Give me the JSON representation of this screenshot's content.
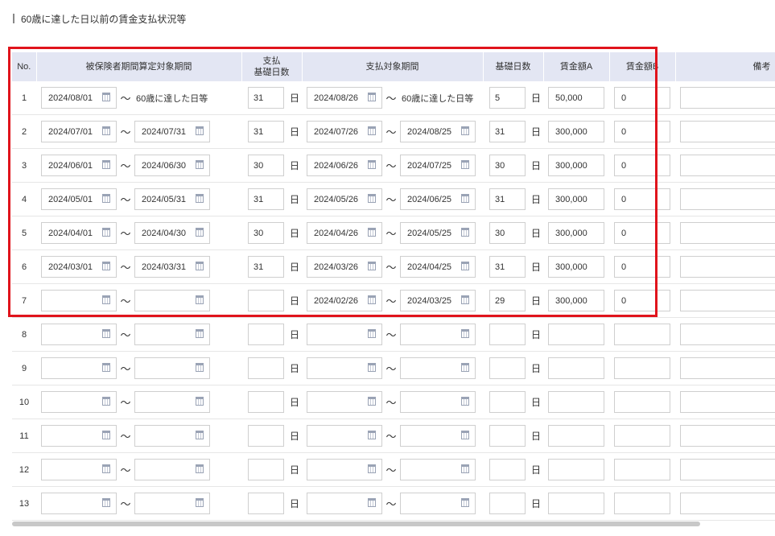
{
  "section_title": "60歳に達した日以前の賃金支払状況等",
  "headers": {
    "no": "No.",
    "insured_period": "被保険者期間算定対象期間",
    "pay_days_line1": "支払",
    "pay_days_line2": "基礎日数",
    "pay_period": "支払対象期間",
    "base_days": "基礎日数",
    "wage_a": "賃金額A",
    "wage_b": "賃金額B",
    "note": "備考"
  },
  "day_unit": "日",
  "tilde": "～",
  "rows": [
    {
      "no": "1",
      "ins_from": "2024/08/01",
      "ins_to": "",
      "ins_to_text": "60歳に達した日等",
      "pay_days": "31",
      "pay_from": "2024/08/26",
      "pay_to": "",
      "pay_to_text": "60歳に達した日等",
      "base_days": "5",
      "wage_a": "50,000",
      "wage_b": "0"
    },
    {
      "no": "2",
      "ins_from": "2024/07/01",
      "ins_to": "2024/07/31",
      "ins_to_text": "",
      "pay_days": "31",
      "pay_from": "2024/07/26",
      "pay_to": "2024/08/25",
      "pay_to_text": "",
      "base_days": "31",
      "wage_a": "300,000",
      "wage_b": "0"
    },
    {
      "no": "3",
      "ins_from": "2024/06/01",
      "ins_to": "2024/06/30",
      "ins_to_text": "",
      "pay_days": "30",
      "pay_from": "2024/06/26",
      "pay_to": "2024/07/25",
      "pay_to_text": "",
      "base_days": "30",
      "wage_a": "300,000",
      "wage_b": "0"
    },
    {
      "no": "4",
      "ins_from": "2024/05/01",
      "ins_to": "2024/05/31",
      "ins_to_text": "",
      "pay_days": "31",
      "pay_from": "2024/05/26",
      "pay_to": "2024/06/25",
      "pay_to_text": "",
      "base_days": "31",
      "wage_a": "300,000",
      "wage_b": "0"
    },
    {
      "no": "5",
      "ins_from": "2024/04/01",
      "ins_to": "2024/04/30",
      "ins_to_text": "",
      "pay_days": "30",
      "pay_from": "2024/04/26",
      "pay_to": "2024/05/25",
      "pay_to_text": "",
      "base_days": "30",
      "wage_a": "300,000",
      "wage_b": "0"
    },
    {
      "no": "6",
      "ins_from": "2024/03/01",
      "ins_to": "2024/03/31",
      "ins_to_text": "",
      "pay_days": "31",
      "pay_from": "2024/03/26",
      "pay_to": "2024/04/25",
      "pay_to_text": "",
      "base_days": "31",
      "wage_a": "300,000",
      "wage_b": "0"
    },
    {
      "no": "7",
      "ins_from": "",
      "ins_to": "",
      "ins_to_text": "",
      "pay_days": "",
      "pay_from": "2024/02/26",
      "pay_to": "2024/03/25",
      "pay_to_text": "",
      "base_days": "29",
      "wage_a": "300,000",
      "wage_b": "0"
    },
    {
      "no": "8",
      "ins_from": "",
      "ins_to": "",
      "ins_to_text": "",
      "pay_days": "",
      "pay_from": "",
      "pay_to": "",
      "pay_to_text": "",
      "base_days": "",
      "wage_a": "",
      "wage_b": ""
    },
    {
      "no": "9",
      "ins_from": "",
      "ins_to": "",
      "ins_to_text": "",
      "pay_days": "",
      "pay_from": "",
      "pay_to": "",
      "pay_to_text": "",
      "base_days": "",
      "wage_a": "",
      "wage_b": ""
    },
    {
      "no": "10",
      "ins_from": "",
      "ins_to": "",
      "ins_to_text": "",
      "pay_days": "",
      "pay_from": "",
      "pay_to": "",
      "pay_to_text": "",
      "base_days": "",
      "wage_a": "",
      "wage_b": ""
    },
    {
      "no": "11",
      "ins_from": "",
      "ins_to": "",
      "ins_to_text": "",
      "pay_days": "",
      "pay_from": "",
      "pay_to": "",
      "pay_to_text": "",
      "base_days": "",
      "wage_a": "",
      "wage_b": ""
    },
    {
      "no": "12",
      "ins_from": "",
      "ins_to": "",
      "ins_to_text": "",
      "pay_days": "",
      "pay_from": "",
      "pay_to": "",
      "pay_to_text": "",
      "base_days": "",
      "wage_a": "",
      "wage_b": ""
    },
    {
      "no": "13",
      "ins_from": "",
      "ins_to": "",
      "ins_to_text": "",
      "pay_days": "",
      "pay_from": "",
      "pay_to": "",
      "pay_to_text": "",
      "base_days": "",
      "wage_a": "",
      "wage_b": ""
    }
  ],
  "colors": {
    "header_bg": "#e3e6f3",
    "highlight": "#e0141c",
    "input_border": "#cfcfcf"
  },
  "icons": {
    "date_picker": "calendar-icon"
  }
}
